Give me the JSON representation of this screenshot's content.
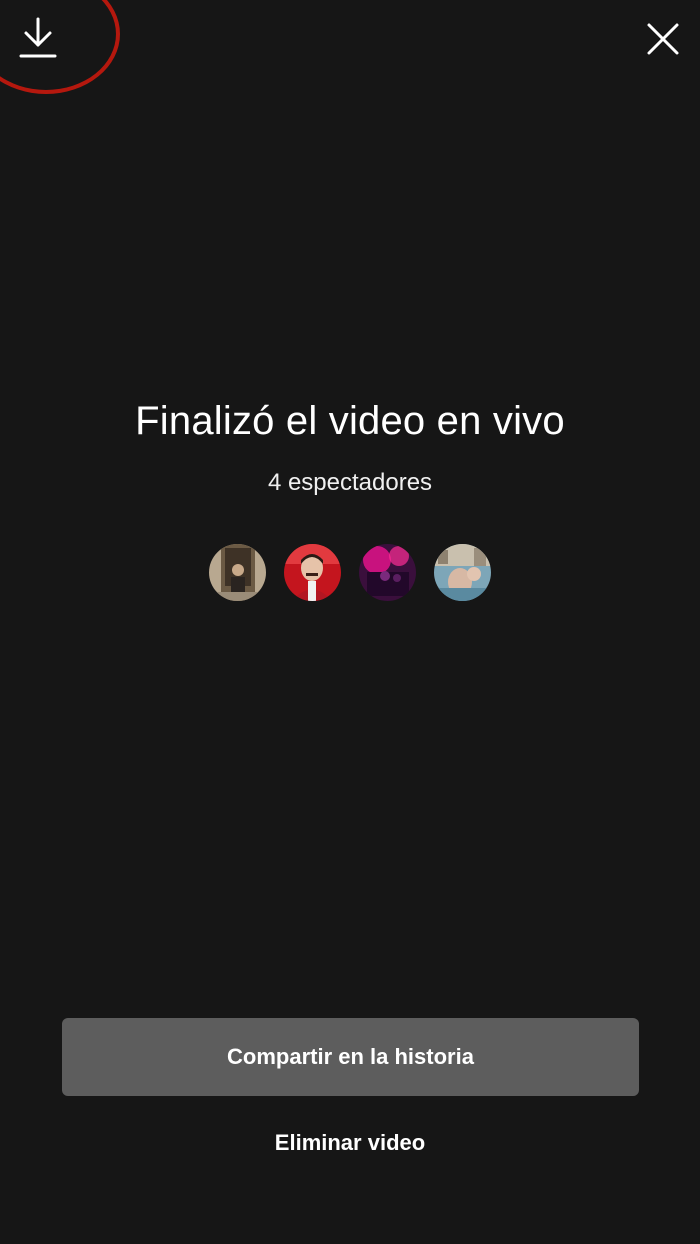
{
  "header": {
    "download_icon": "download-icon",
    "close_icon": "close-icon"
  },
  "live_summary": {
    "title": "Finalizó el video en vivo",
    "viewers_text": "4 espectadores",
    "viewer_avatars": [
      "avatar-1",
      "avatar-2",
      "avatar-3",
      "avatar-4"
    ]
  },
  "actions": {
    "share_label": "Compartir en la historia",
    "delete_label": "Eliminar video"
  },
  "colors": {
    "background": "#161616",
    "button_bg": "#5d5d5d",
    "highlight_ring": "#b5180e",
    "text": "#ffffff"
  }
}
